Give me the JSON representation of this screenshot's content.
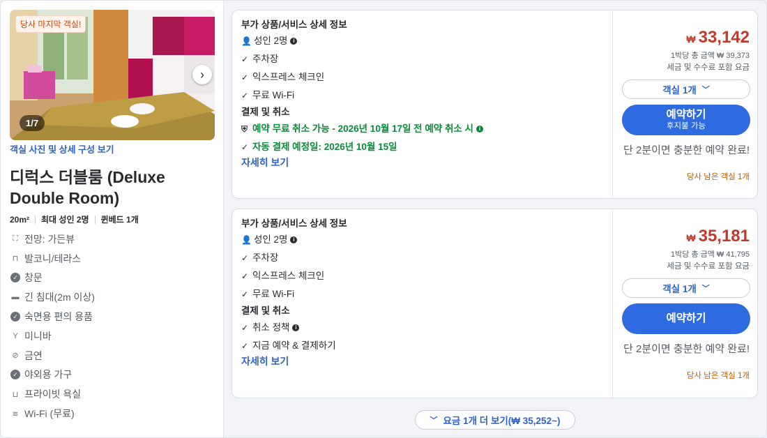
{
  "room": {
    "last_room_badge": "당사 마지막 객실!",
    "photo_counter": "1/7",
    "photo_link": "객실 사진 및 상세 구성 보기",
    "title": "디럭스 더블룸 (Deluxe Double Room)",
    "size": "20m²",
    "max_guests": "최대 성인 2명",
    "bed": "퀸베드 1개",
    "amenities": [
      {
        "icon": "view-icon",
        "label": "전망: 가든뷰"
      },
      {
        "icon": "balcony-icon",
        "label": "발코니/테라스"
      },
      {
        "icon": "check-circle-icon",
        "label": "창문"
      },
      {
        "icon": "bed-icon",
        "label": "긴 침대(2m 이상)"
      },
      {
        "icon": "check-circle-icon",
        "label": "숙면용 편의 용품"
      },
      {
        "icon": "cocktail-icon",
        "label": "미니바"
      },
      {
        "icon": "no-smoking-icon",
        "label": "금연"
      },
      {
        "icon": "check-circle-icon",
        "label": "야외용 가구"
      },
      {
        "icon": "bathtub-icon",
        "label": "프라이빗 욕실"
      },
      {
        "icon": "wifi-icon",
        "label": "Wi-Fi (무료)"
      }
    ]
  },
  "offers": [
    {
      "section_title": "부가 상품/서비스 상세 정보",
      "guests": "성인 2명",
      "features": [
        "주차장",
        "익스프레스 체크인",
        "무료 Wi-Fi"
      ],
      "payment_title": "결제 및 취소",
      "cancel_text": "예약 무료 취소 가능 - 2026년 10월 17일 전 예약 취소 시",
      "pay_date_text": "자동 결제 예정일: 2026년 10월 15일",
      "more_link": "자세히 보기",
      "currency": "₩",
      "price": "33,142",
      "per_night": "1박당 총 금액 ₩ 39,373",
      "tax_note": "세금 및 수수료 포함 요금",
      "room_select": "객실 1개",
      "book_label": "예약하기",
      "book_sub": "후지불 가능",
      "promo": "단 2분이면 충분한 예약 완료!",
      "left_note": "당사 남은 객실 1개"
    },
    {
      "section_title": "부가 상품/서비스 상세 정보",
      "guests": "성인 2명",
      "features": [
        "주차장",
        "익스프레스 체크인",
        "무료 Wi-Fi"
      ],
      "payment_title": "결제 및 취소",
      "policy_text": "취소 정책",
      "pay_now_text": "지금 예약 & 결제하기",
      "more_link": "자세히 보기",
      "currency": "₩",
      "price": "35,181",
      "per_night": "1박당 총 금액 ₩ 41,795",
      "tax_note": "세금 및 수수료 포함 요금",
      "room_select": "객실 1개",
      "book_label": "예약하기",
      "promo": "단 2분이면 충분한 예약 완료!",
      "left_note": "당사 남은 객실 1개"
    }
  ],
  "more_rates": "요금 1개 더 보기(₩ 35,252~)",
  "colors": {
    "accent": "#2e6be0",
    "link": "#2d62c8",
    "price": "#c0392b",
    "green": "#0a8a3a",
    "warning": "#b85c00"
  }
}
